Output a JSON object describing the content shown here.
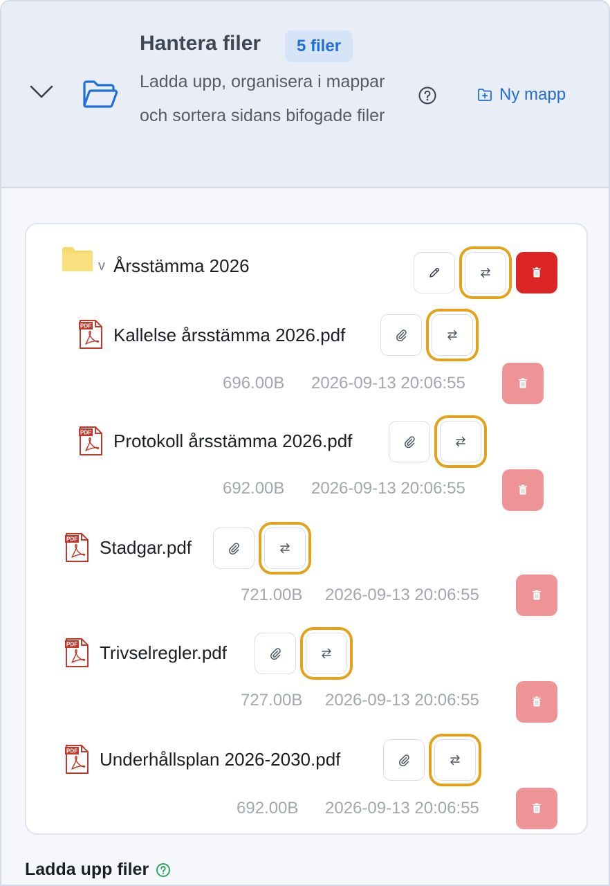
{
  "header": {
    "title": "Hantera filer",
    "badge": "5 filer",
    "description": "Ladda upp, organisera i mappar och sortera sidans bifogade filer",
    "new_folder_label": "Ny mapp"
  },
  "folder": {
    "caret": "v",
    "name": "Årsstämma 2026",
    "files": [
      {
        "name": "Kallelse årsstämma 2026.pdf",
        "size": "696.00B",
        "date": "2026-09-13 20:06:55"
      },
      {
        "name": "Protokoll årsstämma 2026.pdf",
        "size": "692.00B",
        "date": "2026-09-13 20:06:55"
      }
    ]
  },
  "root_files": [
    {
      "name": "Stadgar.pdf",
      "size": "721.00B",
      "date": "2026-09-13 20:06:55"
    },
    {
      "name": "Trivselregler.pdf",
      "size": "727.00B",
      "date": "2026-09-13 20:06:55"
    },
    {
      "name": "Underhållsplan 2026-2030.pdf",
      "size": "692.00B",
      "date": "2026-09-13 20:06:55"
    }
  ],
  "upload": {
    "title": "Ladda upp filer"
  },
  "colors": {
    "accent": "#1f6fd8",
    "focus_ring": "#e3a21a",
    "danger": "#dc2626",
    "danger_soft": "#ee9496",
    "folder": "#f6da6e",
    "pdf": "#c0392b"
  },
  "icons": {
    "collapse": "chevron-down-icon",
    "folder_open": "folder-open-icon",
    "help": "question-circle-icon",
    "new_folder": "folder-plus-icon",
    "edit": "pencil-icon",
    "move": "arrows-swap-icon",
    "delete": "trash-icon",
    "attach": "paperclip-icon",
    "file": "pdf-file-icon"
  }
}
